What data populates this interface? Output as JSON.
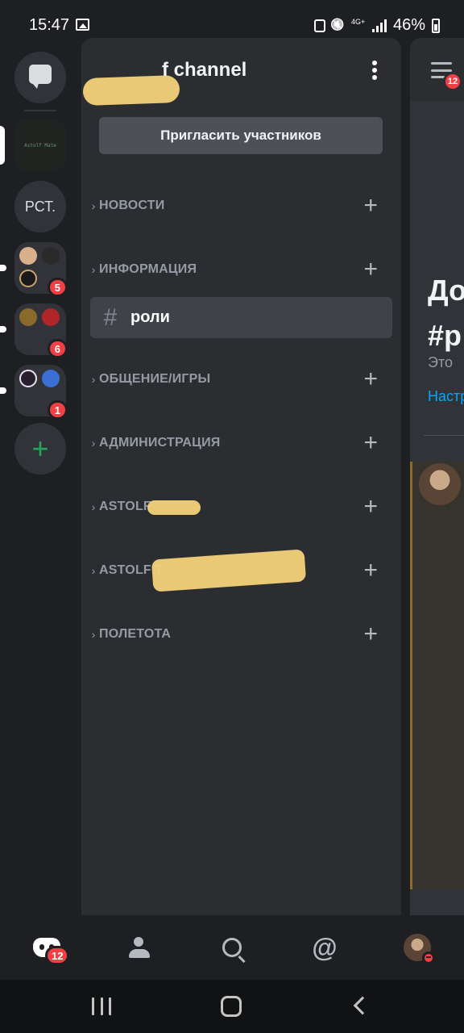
{
  "status_bar": {
    "time": "15:47",
    "network": "4G+",
    "battery": "46%"
  },
  "servers": {
    "folder_badges": [
      "5",
      "6",
      "1"
    ],
    "text_server_label": "РСТ.",
    "mini_server_text": "Astolf Mate"
  },
  "panel": {
    "server_title": "f channel",
    "invite_button": "Пригласить участников",
    "categories": [
      {
        "name": "НОВОСТИ"
      },
      {
        "name": "ИНФОРМАЦИЯ"
      },
      {
        "name": "ОБЩЕНИЕ/ИГРЫ"
      },
      {
        "name": "АДМИНИСТРАЦИЯ"
      },
      {
        "name": "ASTOLF"
      },
      {
        "name": "ASTOLF T"
      },
      {
        "name": "ПОЛЕТОТА"
      }
    ],
    "selected_channel": "роли"
  },
  "chat": {
    "menu_badge": "12",
    "welcome_line1": "До",
    "welcome_line2": "#р",
    "subtitle": "Это",
    "link": "Настр"
  },
  "tab_bar": {
    "home_badge": "12"
  },
  "colors": {
    "background": "#1e1f22",
    "panel": "#2b2d31",
    "selected_row": "#404249",
    "mention_red": "#f23f43",
    "add_green": "#23a55a",
    "link_blue": "#00a8fc"
  }
}
